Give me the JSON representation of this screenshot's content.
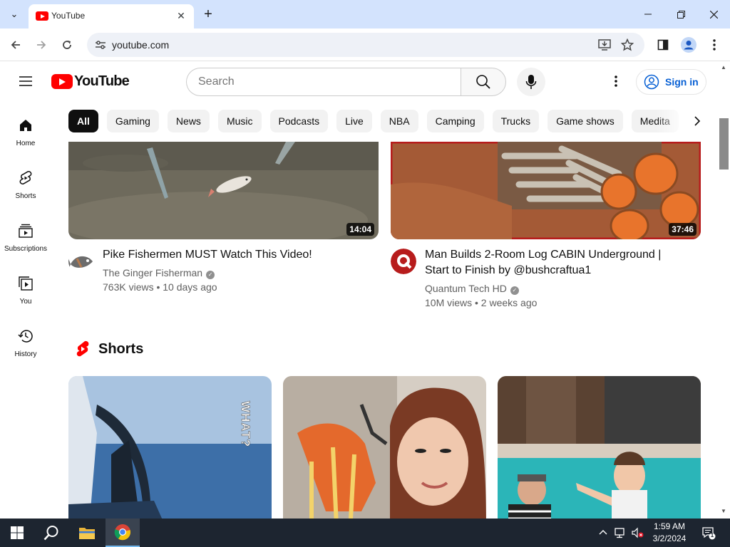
{
  "browser": {
    "tab_title": "YouTube",
    "url": "youtube.com"
  },
  "masthead": {
    "logo_text": "YouTube",
    "search_placeholder": "Search",
    "sign_in": "Sign in"
  },
  "guide": [
    {
      "label": "Home",
      "icon": "home-icon"
    },
    {
      "label": "Shorts",
      "icon": "shorts-icon"
    },
    {
      "label": "Subscriptions",
      "icon": "subscriptions-icon"
    },
    {
      "label": "You",
      "icon": "you-icon"
    },
    {
      "label": "History",
      "icon": "history-icon"
    }
  ],
  "chips": [
    "All",
    "Gaming",
    "News",
    "Music",
    "Podcasts",
    "Live",
    "NBA",
    "Camping",
    "Trucks",
    "Game shows",
    "Medita"
  ],
  "videos": [
    {
      "title_line1": "Pike Fishermen MUST Watch This Video!",
      "title_line2": "",
      "channel": "The Ginger Fisherman",
      "meta": "763K views • 10 days ago",
      "duration": "14:04"
    },
    {
      "title_line1": "Man Builds 2-Room Log CABIN Underground |",
      "title_line2": "Start to Finish by @bushcraftua1",
      "channel": "Quantum Tech HD",
      "meta": "10M views • 2 weeks ago",
      "duration": "37:46"
    }
  ],
  "shorts": {
    "heading": "Shorts",
    "overlay_text": "WHAT?"
  },
  "taskbar": {
    "time": "1:59 AM",
    "date": "3/2/2024",
    "notification_count": "1"
  },
  "colors": {
    "yt_red": "#ff0000",
    "link_blue": "#065fd4",
    "chrome_tabbar": "#d3e3fd",
    "taskbar": "#1d2530"
  }
}
